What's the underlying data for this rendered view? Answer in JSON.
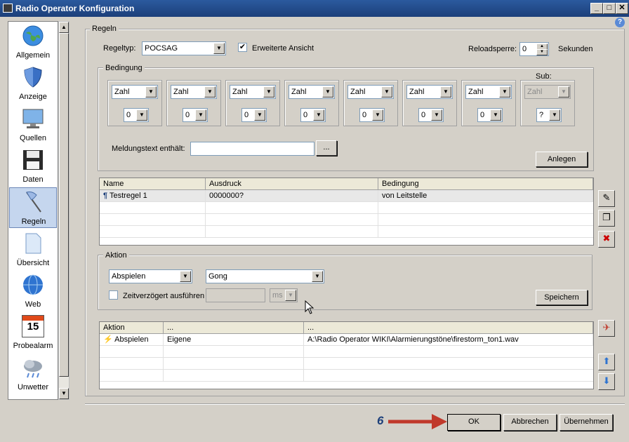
{
  "window": {
    "title": "Radio Operator Konfiguration",
    "help": "?"
  },
  "sidebar": {
    "items": [
      {
        "label": "Allgemein",
        "icon": "globe-icon"
      },
      {
        "label": "Anzeige",
        "icon": "shield-icon"
      },
      {
        "label": "Quellen",
        "icon": "monitor-icon"
      },
      {
        "label": "Daten",
        "icon": "floppy-disk-icon"
      },
      {
        "label": "Regeln",
        "icon": "flag-icon",
        "selected": true
      },
      {
        "label": "Übersicht",
        "icon": "document-icon"
      },
      {
        "label": "Web",
        "icon": "web-globe-icon"
      },
      {
        "label": "Probealarm",
        "icon": "calendar-icon",
        "calendar_day": "15"
      },
      {
        "label": "Unwetter",
        "icon": "storm-cloud-icon"
      }
    ]
  },
  "regeln": {
    "group_label": "Regeln",
    "regeltyp_label": "Regeltyp:",
    "regeltyp_value": "POCSAG",
    "erweitert_label": "Erweiterte Ansicht",
    "erweitert_checked": "✔",
    "reload_label": "Reloadsperre:",
    "reload_value": "0",
    "reload_unit": "Sekunden"
  },
  "bedingung": {
    "group_label": "Bedingung",
    "sub_label": "Sub:",
    "boxes": [
      {
        "type": "Zahl",
        "value": "0"
      },
      {
        "type": "Zahl",
        "value": "0"
      },
      {
        "type": "Zahl",
        "value": "0"
      },
      {
        "type": "Zahl",
        "value": "0"
      },
      {
        "type": "Zahl",
        "value": "0"
      },
      {
        "type": "Zahl",
        "value": "0"
      },
      {
        "type": "Zahl",
        "value": "0"
      },
      {
        "type": "Zahl",
        "value": "?"
      }
    ],
    "meldung_label": "Meldungstext enthält:",
    "meldung_value": "",
    "browse_label": "...",
    "anlegen_label": "Anlegen"
  },
  "rules_table": {
    "headers": [
      "Name",
      "Ausdruck",
      "Bedingung"
    ],
    "rows": [
      {
        "name": "Testregel 1",
        "ausdruck": "0000000?",
        "bedingung": "von Leitstelle"
      }
    ]
  },
  "aktion": {
    "group_label": "Aktion",
    "action_value": "Abspielen",
    "sound_value": "Gong",
    "delay_label": "Zeitverzögert ausführen",
    "delay_value": "",
    "delay_unit": "ms",
    "speichern_label": "Speichern"
  },
  "actions_table": {
    "headers": [
      "Aktion",
      "...",
      "..."
    ],
    "rows": [
      {
        "aktion": "Abspielen",
        "col2": "Eigene",
        "col3": "A:\\Radio Operator WIKI\\Alarmierungstöne\\firestorm_ton1.wav"
      }
    ]
  },
  "annotation": {
    "step": "6",
    "color": "#c0392b"
  },
  "footer": {
    "ok": "OK",
    "cancel": "Abbrechen",
    "apply": "Übernehmen"
  }
}
